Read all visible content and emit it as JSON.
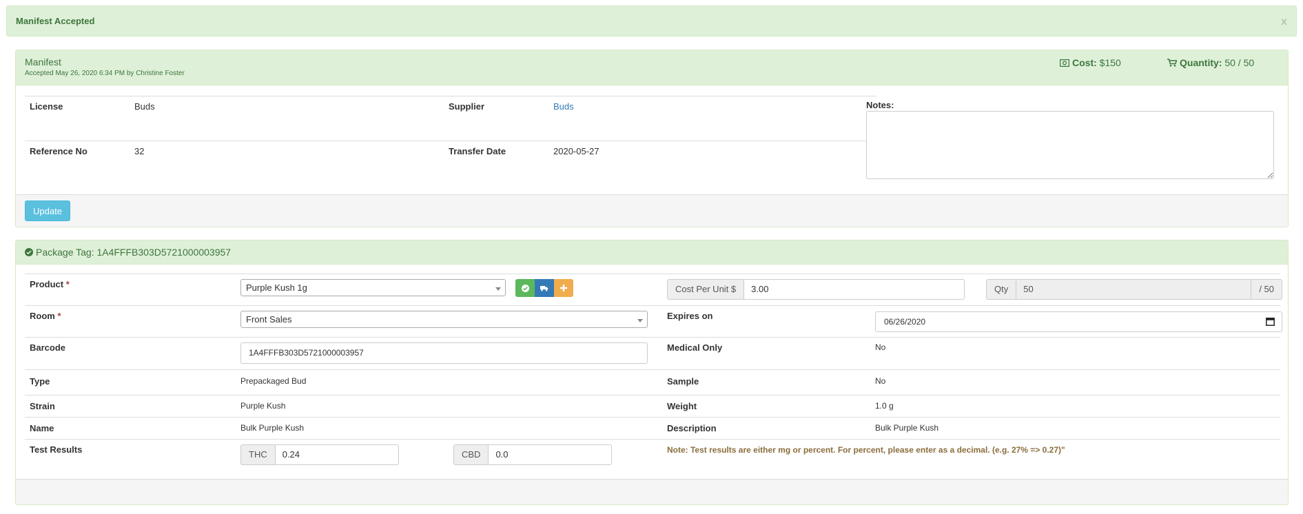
{
  "alert": {
    "text": "Manifest Accepted",
    "close": "x"
  },
  "manifest": {
    "title": "Manifest",
    "subtitle": "Accepted May 26, 2020 6:34 PM by Christine Foster",
    "cost_label": "Cost:",
    "cost_value": "$150",
    "quantity_label": "Quantity:",
    "quantity_value": "50 / 50",
    "fields": {
      "license_label": "License",
      "license_value": "Buds",
      "supplier_label": "Supplier",
      "supplier_value": "Buds",
      "reference_label": "Reference No",
      "reference_value": "32",
      "transfer_label": "Transfer Date",
      "transfer_value": "2020-05-27"
    },
    "notes_label": "Notes:",
    "notes_value": "",
    "update_label": "Update"
  },
  "package": {
    "title": "Package Tag: 1A4FFFB303D5721000003957",
    "product_label": "Product",
    "product_value": "Purple Kush 1g",
    "cost_per_unit_label": "Cost Per Unit $",
    "cost_per_unit_value": "3.00",
    "qty_label": "Qty",
    "qty_value": "50",
    "qty_total": "/ 50",
    "room_label": "Room",
    "room_value": "Front Sales",
    "expires_label": "Expires on",
    "expires_value": "06/26/2020",
    "barcode_label": "Barcode",
    "barcode_value": "1A4FFFB303D5721000003957",
    "medical_label": "Medical Only",
    "medical_value": "No",
    "type_label": "Type",
    "type_value": "Prepackaged Bud",
    "sample_label": "Sample",
    "sample_value": "No",
    "strain_label": "Strain",
    "strain_value": "Purple Kush",
    "weight_label": "Weight",
    "weight_value": "1.0 g",
    "name_label": "Name",
    "name_value": "Bulk Purple Kush",
    "description_label": "Description",
    "description_value": "Bulk Purple Kush",
    "test_label": "Test Results",
    "thc_label": "THC",
    "thc_value": "0.24",
    "cbd_label": "CBD",
    "cbd_value": "0.0",
    "note": "Note: Test results are either mg or percent. For percent, please enter as a decimal. (e.g. 27% => 0.27)\"",
    "required_mark": "*"
  },
  "colors": {
    "success_bg": "#dff0d8",
    "success_text": "#3c763d",
    "info_button": "#5bc0de",
    "green_button": "#5cb85c",
    "blue_button": "#337ab7",
    "orange_button": "#f0ad4e",
    "warning_text": "#8a6d3b"
  }
}
